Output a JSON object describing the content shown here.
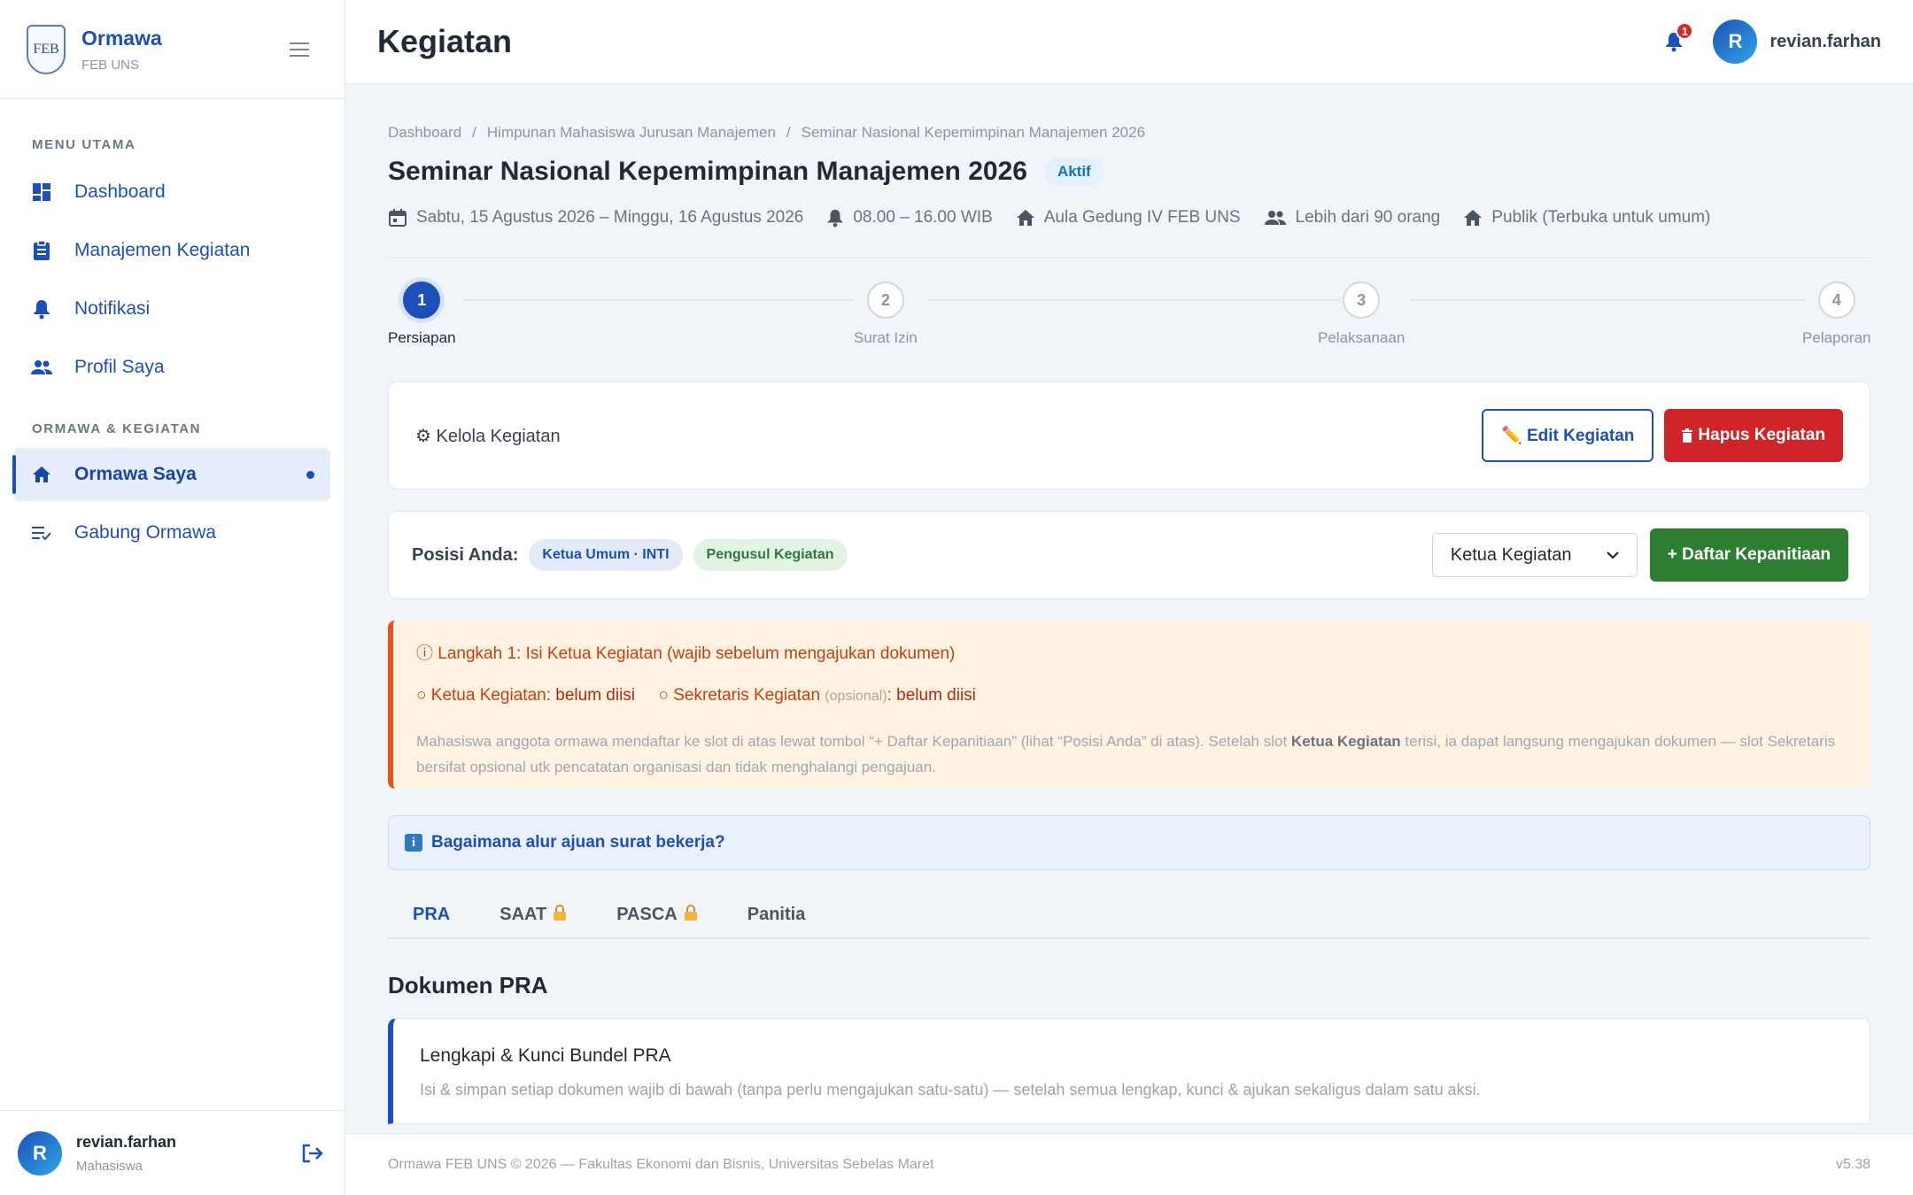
{
  "app": {
    "name": "Ormawa",
    "sub": "FEB UNS",
    "logo_text": "FEB"
  },
  "sidebar": {
    "section_main": "MENU UTAMA",
    "section_org": "ORMAWA & KEGIATAN",
    "items": [
      {
        "label": "Dashboard",
        "icon": "dashboard-icon"
      },
      {
        "label": "Manajemen Kegiatan",
        "icon": "clipboard-icon"
      },
      {
        "label": "Notifikasi",
        "icon": "bell-icon"
      },
      {
        "label": "Profil Saya",
        "icon": "people-icon"
      },
      {
        "label": "Ormawa Saya",
        "icon": "home-icon",
        "active": true
      },
      {
        "label": "Gabung Ormawa",
        "icon": "list-add-icon"
      }
    ],
    "user": {
      "initial": "R",
      "name": "revian.farhan",
      "role": "Mahasiswa"
    }
  },
  "topbar": {
    "title": "Kegiatan",
    "notif_count": "1",
    "user_initial": "R",
    "user_name": "revian.farhan"
  },
  "breadcrumb": [
    "Dashboard",
    "Himpunan Mahasiswa Jurusan Manajemen",
    "Seminar Nasional Kepemimpinan Manajemen 2026"
  ],
  "activity": {
    "title": "Seminar Nasional Kepemimpinan Manajemen 2026",
    "status": "Aktif",
    "date": "Sabtu, 15 Agustus 2026 – Minggu, 16 Agustus 2026",
    "time": "08.00 – 16.00 WIB",
    "place": "Aula Gedung IV FEB UNS",
    "participants": "Lebih dari 90 orang",
    "visibility": "Publik (Terbuka untuk umum)"
  },
  "stepper": [
    {
      "num": "1",
      "label": "Persiapan",
      "active": true
    },
    {
      "num": "2",
      "label": "Surat Izin"
    },
    {
      "num": "3",
      "label": "Pelaksanaan"
    },
    {
      "num": "4",
      "label": "Pelaporan"
    }
  ],
  "kelola": {
    "label": "⚙ Kelola Kegiatan",
    "edit_label": "✏️ Edit Kegiatan",
    "delete_label": "Hapus Kegiatan"
  },
  "posisi": {
    "label": "Posisi Anda:",
    "chip1": "Ketua Umum · INTI",
    "chip2": "Pengusul Kegiatan",
    "select_value": "Ketua Kegiatan",
    "register_label": "+ Daftar Kepanitiaan"
  },
  "warning": {
    "title": "ⓘ Langkah 1: Isi Ketua Kegiatan (wajib sebelum mengajukan dokumen)",
    "ketua_label": "Ketua Kegiatan:",
    "ketua_value": "belum diisi",
    "sekretaris_label": "Sekretaris Kegiatan",
    "sekretaris_opt": "(opsional)",
    "sekretaris_value": "belum diisi",
    "desc_1": "Mahasiswa anggota ormawa mendaftar ke slot di atas lewat tombol “+ Daftar Kepanitiaan” (lihat “Posisi Anda” di atas). Setelah slot ",
    "desc_bold": "Ketua Kegiatan",
    "desc_2": " terisi, ia dapat langsung mengajukan dokumen — slot Sekretaris bersifat opsional utk pencatatan organisasi dan tidak menghalangi pengajuan."
  },
  "info": {
    "badge": "i",
    "text": "Bagaimana alur ajuan surat bekerja?"
  },
  "tabs": [
    {
      "label": "PRA",
      "active": true,
      "locked": false
    },
    {
      "label": "SAAT",
      "locked": true
    },
    {
      "label": "PASCA",
      "locked": true
    },
    {
      "label": "Panitia",
      "locked": false
    }
  ],
  "section": {
    "title": "Dokumen PRA"
  },
  "bundle": {
    "title": "Lengkapi & Kunci Bundel PRA",
    "desc": "Isi & simpan setiap dokumen wajib di bawah (tanpa perlu mengajukan satu-satu) — setelah semua lengkap, kunci & ajukan sekaligus dalam satu aksi."
  },
  "footer": {
    "text": "Ormawa FEB UNS © 2026 — Fakultas Ekonomi dan Bisnis, Universitas Sebelas Maret",
    "version": "v5.38"
  },
  "colors": {
    "primary": "#1d4fb8",
    "danger": "#cf2429",
    "success": "#2d7d32",
    "warning": "#e1581a"
  }
}
